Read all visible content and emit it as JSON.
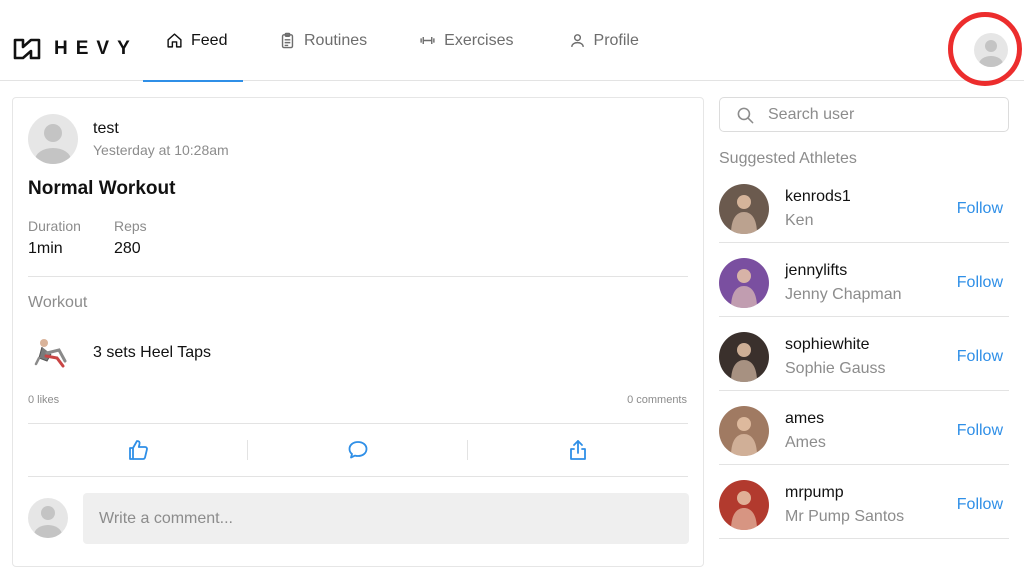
{
  "brand": {
    "name": "HEVY",
    "logo_icon": "hevy-logo-icon"
  },
  "nav": {
    "tabs": [
      {
        "label": "Feed",
        "icon": "home-icon",
        "active": true
      },
      {
        "label": "Routines",
        "icon": "clipboard-icon",
        "active": false
      },
      {
        "label": "Exercises",
        "icon": "dumbbell-icon",
        "active": false
      },
      {
        "label": "Profile",
        "icon": "user-icon",
        "active": false
      }
    ]
  },
  "colors": {
    "accent": "#2f8fe7",
    "highlight_ring": "#ec2d2d",
    "muted_text": "#8c8c8c"
  },
  "post": {
    "user": "test",
    "time": "Yesterday at 10:28am",
    "title": "Normal Workout",
    "stats": [
      {
        "label": "Duration",
        "value": "1min"
      },
      {
        "label": "Reps",
        "value": "280"
      }
    ],
    "section_label": "Workout",
    "exercise": "3 sets Heel Taps",
    "likes": "0 likes",
    "comments": "0 comments",
    "comment_placeholder": "Write a comment..."
  },
  "sidebar": {
    "search_placeholder": "Search user",
    "suggested_title": "Suggested Athletes",
    "follow_label": "Follow",
    "athletes": [
      {
        "username": "kenrods1",
        "name": "Ken",
        "avatar_color": "#6b5a4e"
      },
      {
        "username": "jennylifts",
        "name": "Jenny Chapman",
        "avatar_color": "#7a4fa0"
      },
      {
        "username": "sophiewhite",
        "name": "Sophie Gauss",
        "avatar_color": "#3a302c"
      },
      {
        "username": "ames",
        "name": "Ames",
        "avatar_color": "#a07a62"
      },
      {
        "username": "mrpump",
        "name": "Mr Pump Santos",
        "avatar_color": "#b23a2e"
      }
    ]
  }
}
